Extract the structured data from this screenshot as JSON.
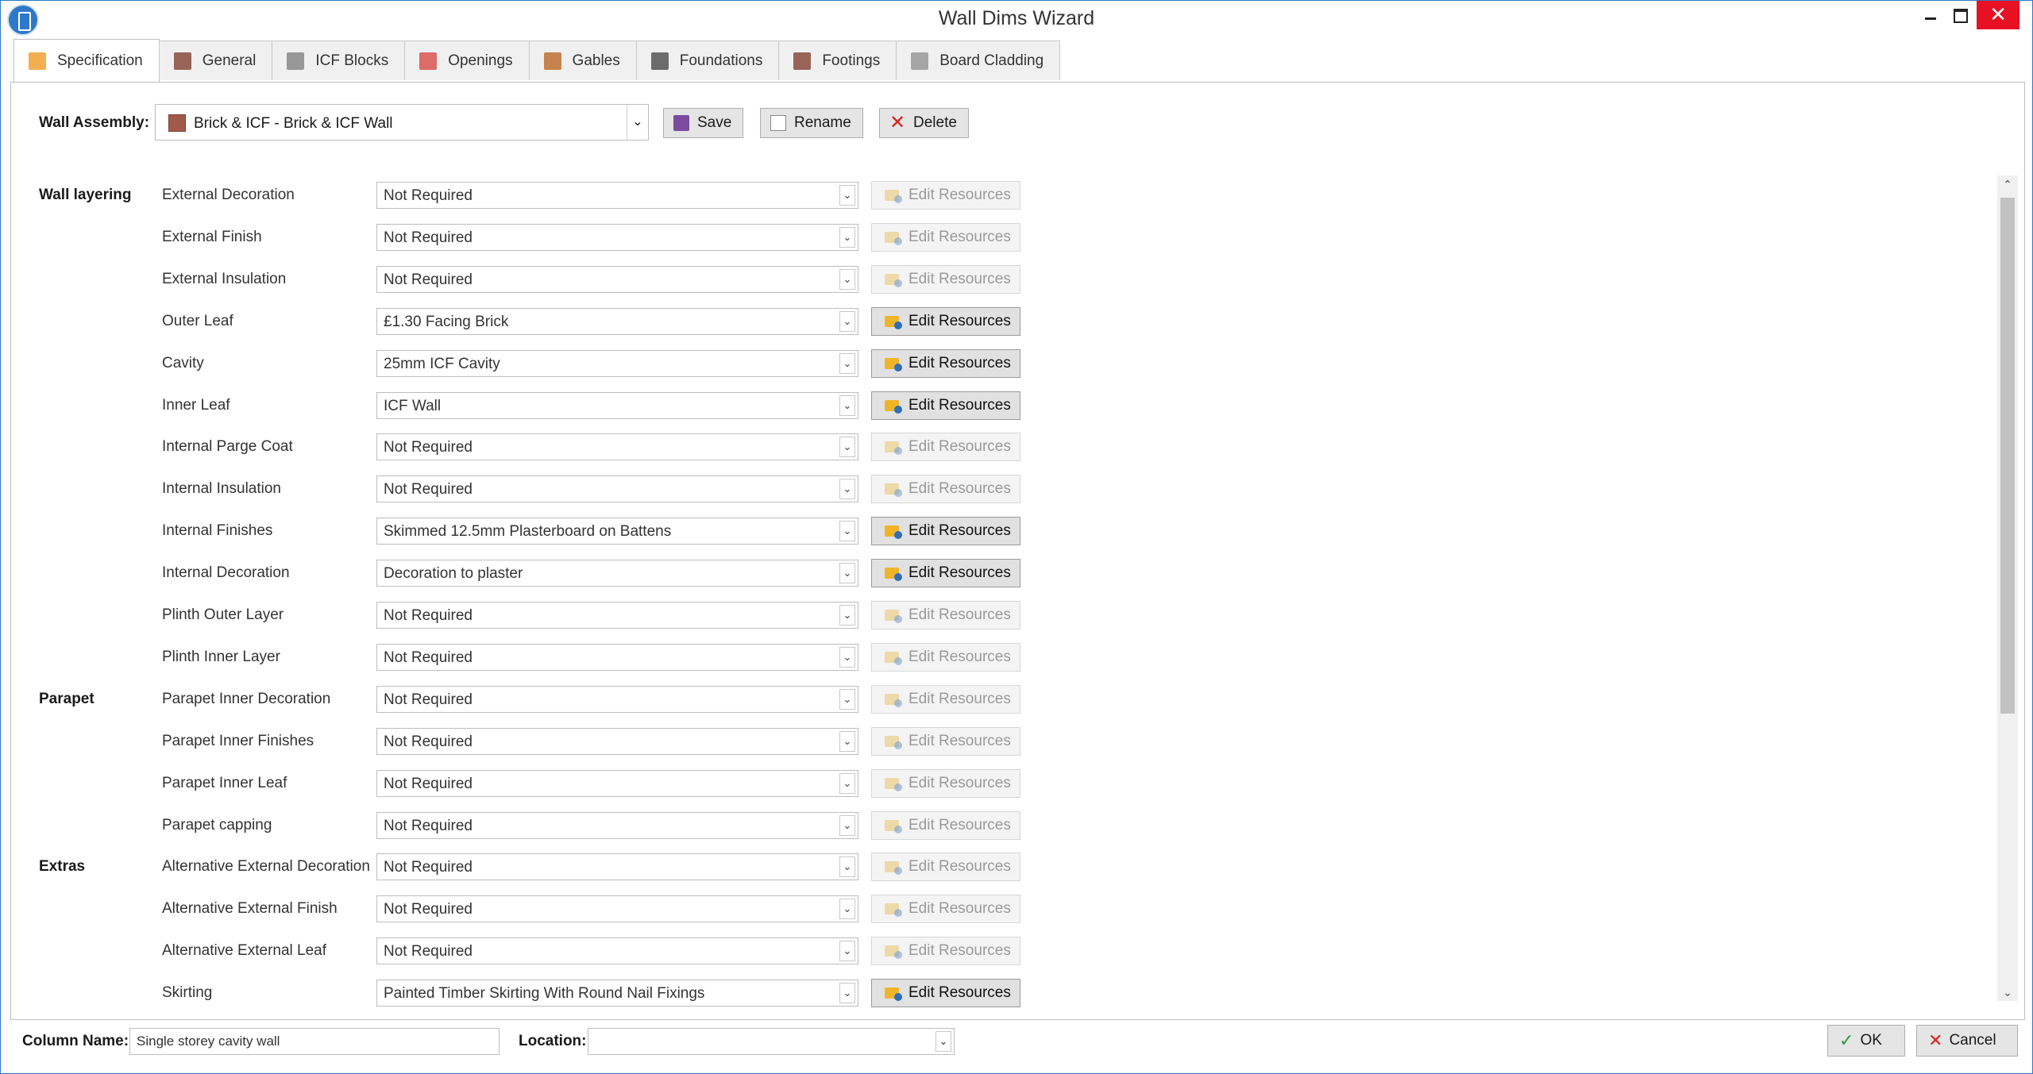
{
  "window": {
    "title": "Wall Dims Wizard"
  },
  "tabs": [
    {
      "label": "Specification",
      "icon": "box-icon",
      "color": "#f0a030"
    },
    {
      "label": "General",
      "icon": "wall-icon",
      "color": "#8a4b3d"
    },
    {
      "label": "ICF Blocks",
      "icon": "grid-icon",
      "color": "#888888"
    },
    {
      "label": "Openings",
      "icon": "opening-icon",
      "color": "#d9534f"
    },
    {
      "label": "Gables",
      "icon": "gable-icon",
      "color": "#c07030"
    },
    {
      "label": "Foundations",
      "icon": "foundation-icon",
      "color": "#555555"
    },
    {
      "label": "Footings",
      "icon": "footing-icon",
      "color": "#8a4b3d"
    },
    {
      "label": "Board Cladding",
      "icon": "board-icon",
      "color": "#999999"
    }
  ],
  "wall_assembly": {
    "label": "Wall Assembly:",
    "value": "Brick & ICF - Brick & ICF Wall",
    "save": "Save",
    "rename": "Rename",
    "delete": "Delete"
  },
  "sections": {
    "wall_layering": "Wall layering",
    "parapet": "Parapet",
    "extras": "Extras"
  },
  "edit_resources_label": "Edit Resources",
  "rows": [
    {
      "label": "External Decoration",
      "value": "Not Required",
      "enabled": false
    },
    {
      "label": "External Finish",
      "value": "Not Required",
      "enabled": false
    },
    {
      "label": "External Insulation",
      "value": "Not Required",
      "enabled": false
    },
    {
      "label": "Outer Leaf",
      "value": "£1.30 Facing Brick",
      "enabled": true
    },
    {
      "label": "Cavity",
      "value": "25mm ICF Cavity",
      "enabled": true
    },
    {
      "label": "Inner Leaf",
      "value": "ICF Wall",
      "enabled": true
    },
    {
      "label": "Internal Parge Coat",
      "value": "Not Required",
      "enabled": false
    },
    {
      "label": "Internal Insulation",
      "value": "Not Required",
      "enabled": false
    },
    {
      "label": "Internal Finishes",
      "value": "Skimmed 12.5mm Plasterboard on Battens",
      "enabled": true
    },
    {
      "label": "Internal Decoration",
      "value": "Decoration to plaster",
      "enabled": true
    },
    {
      "label": "Plinth Outer Layer",
      "value": "Not Required",
      "enabled": false
    },
    {
      "label": "Plinth Inner Layer",
      "value": "Not Required",
      "enabled": false
    },
    {
      "label": "Parapet Inner Decoration",
      "value": "Not Required",
      "enabled": false
    },
    {
      "label": "Parapet Inner Finishes",
      "value": "Not Required",
      "enabled": false
    },
    {
      "label": "Parapet Inner Leaf",
      "value": "Not Required",
      "enabled": false
    },
    {
      "label": "Parapet capping",
      "value": "Not Required",
      "enabled": false
    },
    {
      "label": "Alternative External Decoration",
      "value": "Not Required",
      "enabled": false
    },
    {
      "label": "Alternative External Finish",
      "value": "Not Required",
      "enabled": false
    },
    {
      "label": "Alternative External Leaf",
      "value": "Not Required",
      "enabled": false
    },
    {
      "label": "Skirting",
      "value": "Painted Timber Skirting With Round Nail Fixings",
      "enabled": true
    }
  ],
  "footer": {
    "column_name_label": "Column Name:",
    "column_name_value": "Single storey cavity wall",
    "location_label": "Location:",
    "location_value": "",
    "ok": "OK",
    "cancel": "Cancel"
  }
}
